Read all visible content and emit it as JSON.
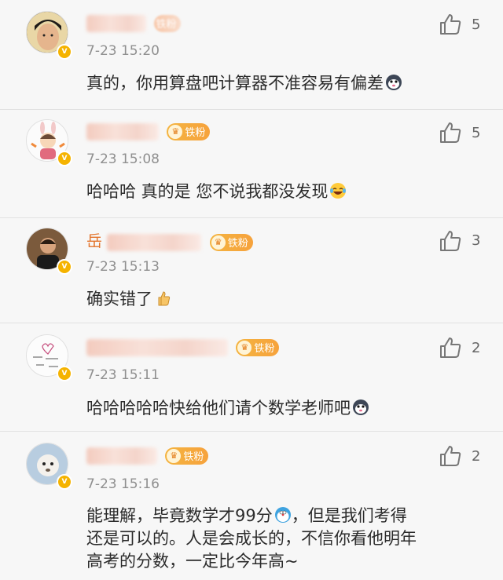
{
  "comments": [
    {
      "name_visible": "",
      "badge": "铁粉",
      "time": "7-23 15:20",
      "text": "真的，你用算盘吧计算器不准容易有偏差",
      "likes": "5",
      "emoji": "husky-emoji"
    },
    {
      "name_visible": "",
      "badge": "铁粉",
      "time": "7-23 15:08",
      "text": "哈哈哈 真的是 您不说我都没发现",
      "likes": "5",
      "emoji": "laugh-cry-emoji"
    },
    {
      "name_visible": "岳",
      "badge": "铁粉",
      "time": "7-23 15:13",
      "text": "确实错了",
      "likes": "3",
      "emoji": "thumbs-up-emoji"
    },
    {
      "name_visible": "",
      "badge": "铁粉",
      "time": "7-23 15:11",
      "text": "哈哈哈哈哈快给他们请个数学老师吧",
      "likes": "2",
      "emoji": "husky-emoji"
    },
    {
      "name_visible": "",
      "badge": "铁粉",
      "time": "7-23 15:16",
      "text_line1_a": "能理解，毕竟数学才99分",
      "text_line1_b": "，但是我们考得",
      "text_line2": "还是可以的。人是会成长的，不信你看他明年",
      "text_line3": "高考的分数，一定比今年高~",
      "likes": "2",
      "emoji": "doraemon-emoji"
    }
  ],
  "colors": {
    "name": "#e3732a",
    "badge": "#f4b441",
    "time": "#8f8f8f",
    "background": "#f7f7f7"
  }
}
